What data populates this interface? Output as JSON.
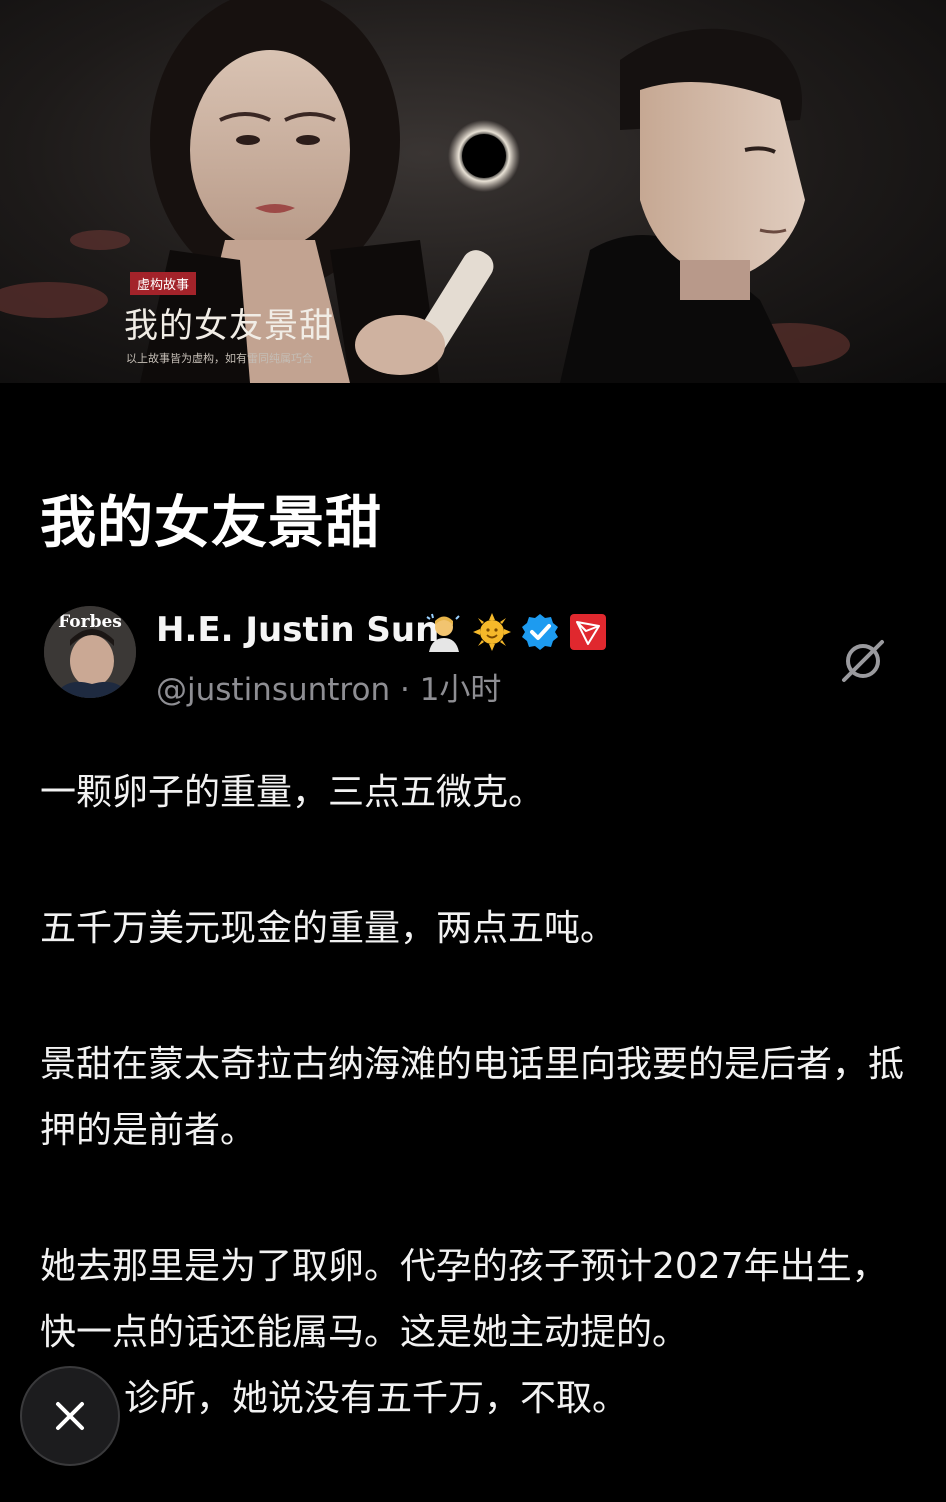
{
  "cover": {
    "badge": "虚构故事",
    "title": "我的女友景甜",
    "disclaimer": "以上故事皆为虚构，如有雷同纯属巧合"
  },
  "article": {
    "title": "我的女友景甜"
  },
  "author": {
    "name": "H.E. Justin Sun",
    "avatar_text": "Forbes",
    "handle": "@justinsuntron",
    "separator": "·",
    "time": "1小时",
    "badges": [
      "person-emoji-icon",
      "sun-emoji-icon",
      "verified-badge-icon",
      "tron-logo-icon"
    ],
    "verified_color": "#1d9bf0",
    "tron_color": "#e0282e"
  },
  "paragraphs": [
    "一颗卵子的重量，三点五微克。",
    "五千万美元现金的重量，两点五吨。",
    "景甜在蒙太奇拉古纳海滩的电话里向我要的是后者，抵押的是前者。",
    "她去那里是为了取卵。代孕的孩子预计2027年出生，快一点的话还能属马。这是她主动提的。",
    "诊所，她说没有五千万，不取。"
  ],
  "icons": {
    "grok": "grok-icon",
    "close": "close-icon"
  }
}
